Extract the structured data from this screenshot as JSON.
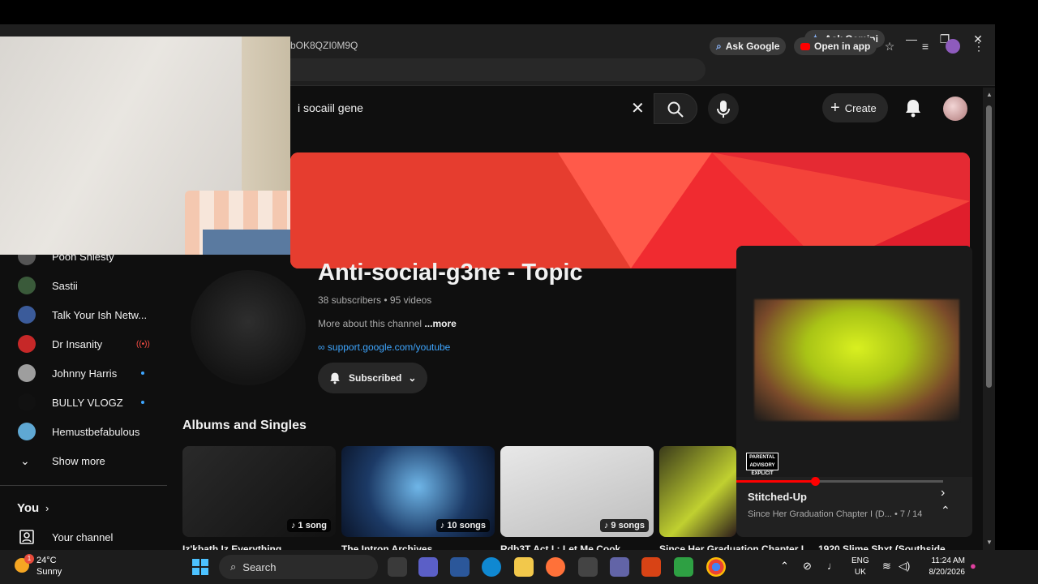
{
  "browser": {
    "ask_gemini": "Ask Gemini",
    "url": "bOK8QZI0M9Q",
    "ask_google": "Ask Google",
    "open_in_app": "Open in app"
  },
  "youtube": {
    "search_value": "i socaiil gene",
    "create_label": "Create"
  },
  "sidebar": {
    "items": [
      {
        "label": "Pooh Shiesty",
        "color": "#555555",
        "indicator": "none"
      },
      {
        "label": "Sastii",
        "color": "#3a5a3a",
        "indicator": "none"
      },
      {
        "label": "Talk Your Ish Netw...",
        "color": "#3b5b9a",
        "indicator": "none"
      },
      {
        "label": "Dr Insanity",
        "color": "#c62828",
        "indicator": "live"
      },
      {
        "label": "Johnny Harris",
        "color": "#9e9e9e",
        "indicator": "dot"
      },
      {
        "label": "BULLY VLOGZ",
        "color": "#111111",
        "indicator": "dot"
      },
      {
        "label": "Hemustbefabulous",
        "color": "#5fa8d3",
        "indicator": "none"
      }
    ],
    "show_more": "Show more",
    "you": "You",
    "your_channel": "Your channel"
  },
  "channel": {
    "title": "Anti-social-g3ne - Topic",
    "subscribers": "38 subscribers",
    "videos": "95 videos",
    "meta_separator": " • ",
    "about": "More about this channel",
    "about_more": "...more",
    "link": "support.google.com/youtube",
    "subscribed_label": "Subscribed"
  },
  "albums": {
    "section_title": "Albums and Singles",
    "items": [
      {
        "name": "Iz'kbath Iz Everything",
        "count": "1 song"
      },
      {
        "name": "The Intron Archives",
        "count": "10 songs"
      },
      {
        "name": "Rdb3T Act I : Let Me Cook",
        "count": "9 songs"
      },
      {
        "name": "Since Her Graduation Chapter I",
        "count": ""
      },
      {
        "name": "1920 Slime Shxt (Southside",
        "count": ""
      }
    ]
  },
  "mini_player": {
    "title": "Stitched-Up",
    "subtitle": "Since Her Graduation Chapter I (D...",
    "position": "• 7 / 14",
    "progress": 0.38,
    "parental_advisory": "PARENTAL ADVISORY EXPLICIT CONTENT"
  },
  "taskbar": {
    "temperature": "24°C",
    "weather": "Sunny",
    "weather_badge": "1",
    "search": "Search",
    "lang_top": "ENG",
    "lang_bottom": "UK",
    "time": "11:24 AM",
    "date": "8/20/2026"
  }
}
